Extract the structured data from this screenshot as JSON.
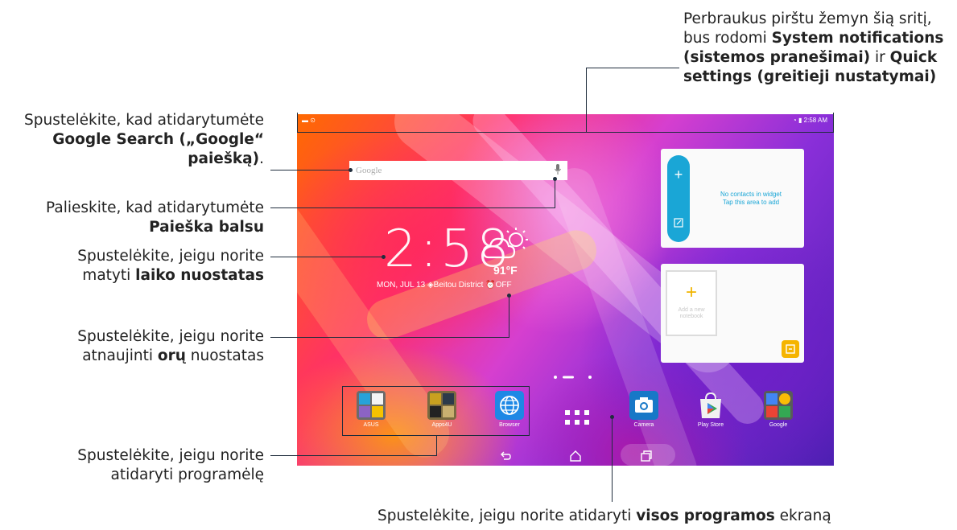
{
  "callouts": {
    "notifications": {
      "line1": "Perbraukus pirštu žemyn šią sritį,",
      "line2_pre": "bus rodomi ",
      "line2_bold": "System notifications",
      "line3_bold": "(sistemos pranešimai)",
      "line3_mid": " ir ",
      "line3_bold2": "Quick",
      "line4_bold": "settings (greitieji nustatymai)"
    },
    "google_search": {
      "line1": "Spustelėkite, kad atidarytumėte",
      "line2_bold": "Google Search („Google“",
      "line3_bold": "paiešką)",
      "line3_end": "."
    },
    "voice_search": {
      "line1": "Palieskite, kad atidarytumėte",
      "line2_bold": "Paieška balsu"
    },
    "time_settings": {
      "line1": "Spustelėkite, jeigu norite",
      "line2_pre": "matyti ",
      "line2_bold": "laiko nuostatas"
    },
    "weather_settings": {
      "line1": "Spustelėkite, jeigu norite",
      "line2_pre": "atnaujinti ",
      "line2_bold": "orų",
      "line2_end": " nuostatas"
    },
    "open_app": {
      "line1": "Spustelėkite, jeigu norite",
      "line2": "atidaryti programėlę"
    },
    "all_apps": {
      "pre": "Spustelėkite, jeigu norite atidaryti ",
      "bold": "visos programos",
      "end": " ekraną"
    }
  },
  "screen": {
    "status_time": "2:58 AM",
    "search_placeholder": "Google",
    "clock": "2:58",
    "temperature": "91°F",
    "date_line": "MON, JUL 13 ◈Beitou District ⏰OFF",
    "contacts_widget": {
      "line1": "No contacts in widget",
      "line2": "Tap this area to add"
    },
    "notebook_widget": {
      "line1": "Add a new",
      "line2": "notebook"
    },
    "apps": [
      "ASUS",
      "Apps4U",
      "Browser",
      "Camera",
      "Play Store",
      "Google"
    ],
    "colors": {
      "contacts_accent": "#1aa6d6",
      "notebook_accent": "#f5b400"
    }
  }
}
